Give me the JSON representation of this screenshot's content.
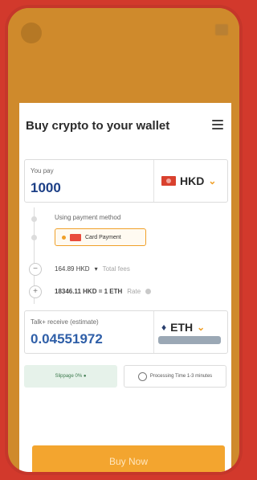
{
  "background": {
    "amount_label": "",
    "amount": "",
    "top_right": ""
  },
  "card": {
    "title": "Buy crypto to your wallet",
    "pay": {
      "label": "You pay",
      "value": "1000",
      "currency": "HKD",
      "currency_icon": "flag-hk-icon"
    },
    "payment_method": {
      "label": "Using payment method",
      "option": "Card Payment"
    },
    "fees": {
      "amount": "164.89 HKD",
      "label": "Total fees"
    },
    "rate": {
      "value": "18346.11 HKD = 1 ETH",
      "label": "Rate"
    },
    "receive": {
      "label": "Talk+ receive (estimate)",
      "value": "0.04551972",
      "currency": "ETH",
      "network_badge": ""
    },
    "slippage": "Slippage 0% ●",
    "processing": "Processing Time 1-3 minutes",
    "buy_button": "Buy Now"
  },
  "colors": {
    "accent": "#f0a029",
    "frame": "#c5362a",
    "header": "#cf8a2c",
    "amount_blue": "#1c3f86"
  }
}
